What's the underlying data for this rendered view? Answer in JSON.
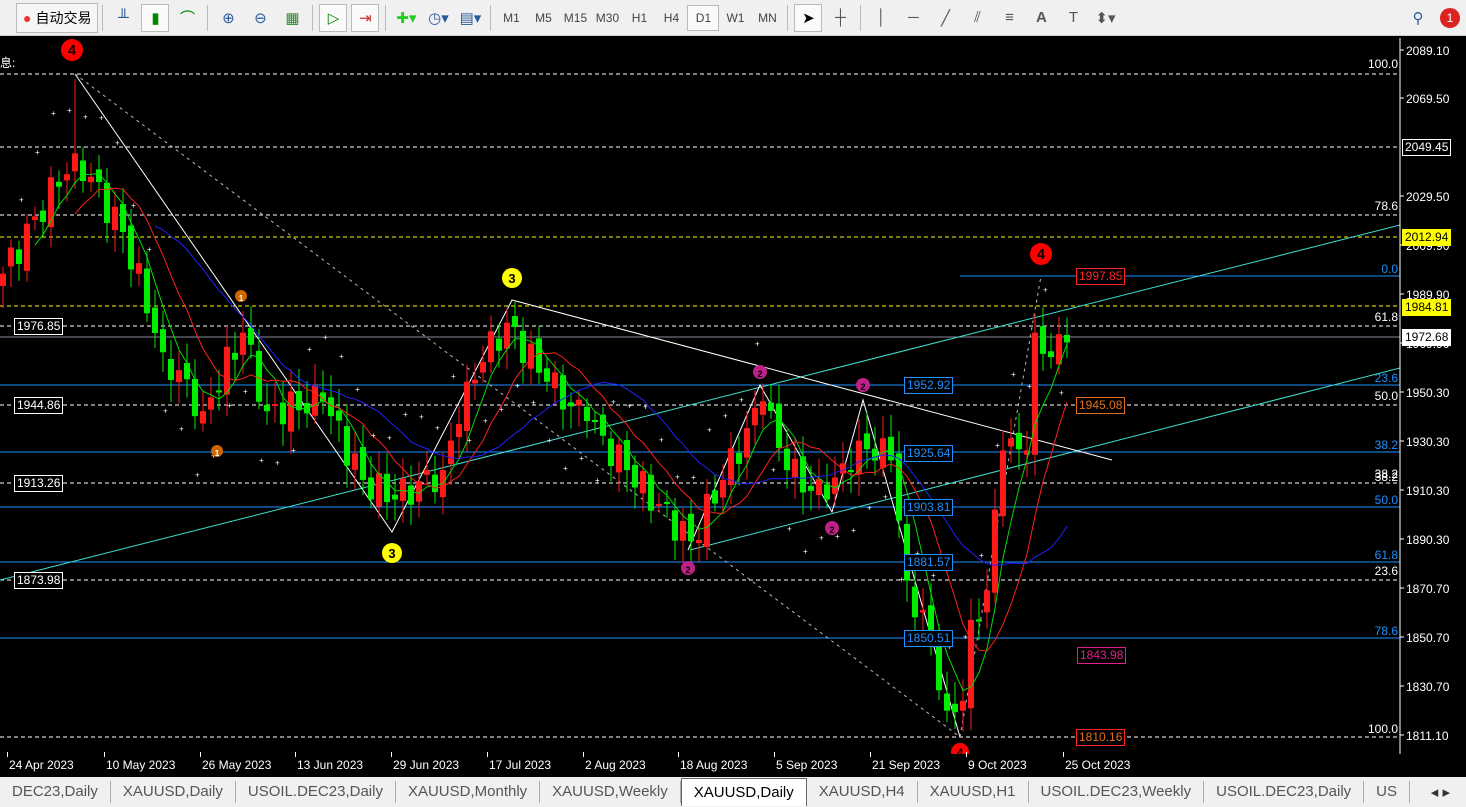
{
  "toolbar": {
    "auto_trade": "自动交易",
    "timeframes": [
      "M1",
      "M5",
      "M15",
      "M30",
      "H1",
      "H4",
      "D1",
      "W1",
      "MN"
    ],
    "active_timeframe": "D1",
    "notification_count": "1"
  },
  "chart": {
    "symbol": "XAUUSD",
    "period": "Daily",
    "corner_text": "息:",
    "price_axis": [
      "2089.10",
      "2069.50",
      "2029.50",
      "2009.90",
      "1989.90",
      "1969.90",
      "1950.30",
      "1930.30",
      "1910.30",
      "1890.30",
      "1870.70",
      "1850.70",
      "1830.70",
      "1811.10"
    ],
    "axis_markers": [
      {
        "v": "2049.45",
        "type": "white"
      },
      {
        "v": "2012.94",
        "type": "yellow"
      },
      {
        "v": "1984.81",
        "type": "yellow"
      },
      {
        "v": "1972.68",
        "type": "white"
      }
    ],
    "left_labels": [
      "1976.85",
      "1944.86",
      "1913.26",
      "1873.98"
    ],
    "fib_white_levels": [
      "100.0",
      "78.6",
      "61.8",
      "50.0",
      "38.2",
      "23.6",
      "100.0"
    ],
    "fib_blue_levels": [
      "0.0",
      "23.6",
      "38.2",
      "50.0",
      "61.8",
      "78.6"
    ],
    "fib_blue_prices": [
      "1952.92",
      "1925.64",
      "1903.81",
      "1881.57",
      "1850.51"
    ],
    "boxes": {
      "top": "1997.85",
      "orange": "1945.08",
      "magenta": "1843.98",
      "bottom": "1810.16"
    },
    "wave_labels": [
      "4",
      "4",
      "4",
      "3",
      "3",
      "1",
      "1",
      "2",
      "2",
      "2",
      "2"
    ]
  },
  "dates": [
    "24 Apr 2023",
    "10 May 2023",
    "26 May 2023",
    "13 Jun 2023",
    "29 Jun 2023",
    "17 Jul 2023",
    "2 Aug 2023",
    "18 Aug 2023",
    "5 Sep 2023",
    "21 Sep 2023",
    "9 Oct 2023",
    "25 Oct 2023"
  ],
  "tabs": [
    "DEC23,Daily",
    "XAUUSD,Daily",
    "USOIL.DEC23,Daily",
    "XAUUSD,Monthly",
    "XAUUSD,Weekly",
    "XAUUSD,Daily",
    "XAUUSD,H4",
    "XAUUSD,H1",
    "USOIL.DEC23,Weekly",
    "USOIL.DEC23,Daily",
    "US"
  ],
  "active_tab": 5,
  "colors": {
    "bull": "#ff1a1a",
    "bear": "#00ee00",
    "fib": "#1e90ff",
    "trend": "#40e0d0",
    "yellow": "#ffff00"
  },
  "chart_data": {
    "type": "candlestick",
    "x_unit": "bar index",
    "ylim": [
      1811.1,
      2089.1
    ],
    "keypoints": [
      [
        0,
        1999
      ],
      [
        9,
        2048
      ],
      [
        15,
        2016
      ],
      [
        20,
        1967
      ],
      [
        25,
        1943
      ],
      [
        30,
        1975
      ],
      [
        33,
        1943
      ],
      [
        40,
        1947
      ],
      [
        45,
        1915
      ],
      [
        49,
        1907
      ],
      [
        55,
        1919
      ],
      [
        58,
        1955
      ],
      [
        63,
        1979
      ],
      [
        68,
        1955
      ],
      [
        73,
        1939
      ],
      [
        78,
        1919
      ],
      [
        86,
        1890
      ],
      [
        90,
        1915
      ],
      [
        95,
        1947
      ],
      [
        98,
        1919
      ],
      [
        103,
        1907
      ],
      [
        107,
        1931
      ],
      [
        111,
        1923
      ],
      [
        113,
        1874
      ],
      [
        116,
        1850
      ],
      [
        118,
        1821
      ],
      [
        120,
        1825
      ],
      [
        121,
        1858
      ],
      [
        123,
        1870
      ],
      [
        125,
        1927
      ],
      [
        128,
        1927
      ],
      [
        129,
        1975
      ],
      [
        131,
        1965
      ],
      [
        133,
        1971
      ]
    ]
  }
}
